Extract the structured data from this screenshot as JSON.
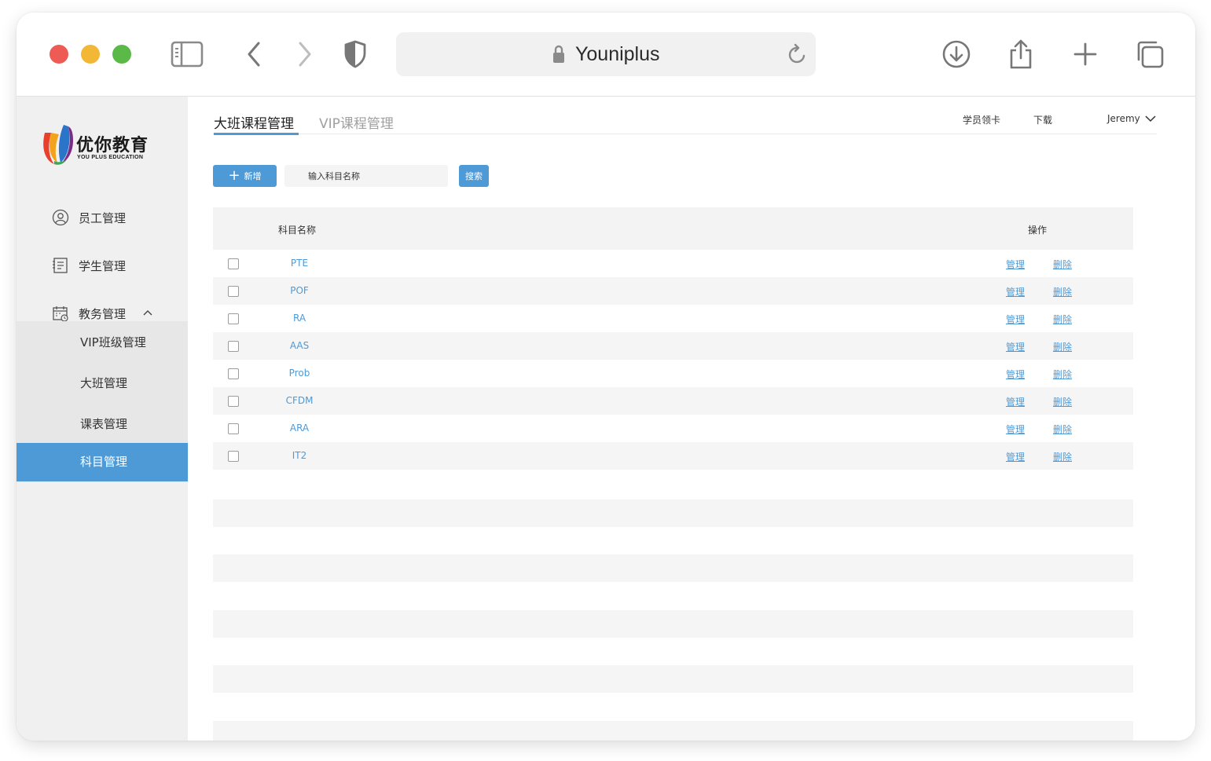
{
  "browser": {
    "url_text": "Youniplus"
  },
  "sidebar": {
    "logo": {
      "brand": "优你教育",
      "brand_sub": "YOU PLUS EDUCATION"
    },
    "items": [
      {
        "label": "员工管理",
        "icon": "user-circle-icon"
      },
      {
        "label": "学生管理",
        "icon": "document-icon"
      },
      {
        "label": "教务管理",
        "icon": "calendar-icon",
        "expanded": true
      }
    ],
    "submenu": [
      {
        "label": "VIP班级管理",
        "active": false
      },
      {
        "label": "大班管理",
        "active": false
      },
      {
        "label": "课表管理",
        "active": false
      },
      {
        "label": "科目管理",
        "active": true
      }
    ]
  },
  "header": {
    "tabs": [
      {
        "label": "大班课程管理",
        "active": true
      },
      {
        "label": "VIP课程管理",
        "active": false
      }
    ],
    "links": {
      "student_card": "学员领卡",
      "download": "下载",
      "user": "Jeremy"
    }
  },
  "toolbar": {
    "add_label": "新增",
    "search_placeholder": "输入科目名称",
    "search_label": "搜索"
  },
  "table": {
    "columns": {
      "name": "科目名称",
      "ops": "操作"
    },
    "manage_label": "管理",
    "delete_label": "删除",
    "rows": [
      "PTE",
      "POF",
      "RA",
      "AAS",
      "Prob",
      "CFDM",
      "ARA",
      "IT2"
    ]
  },
  "colors": {
    "accent": "#4e9ad7",
    "sidebar_bg": "#f0f0f0",
    "stripe": "#f5f5f5"
  }
}
